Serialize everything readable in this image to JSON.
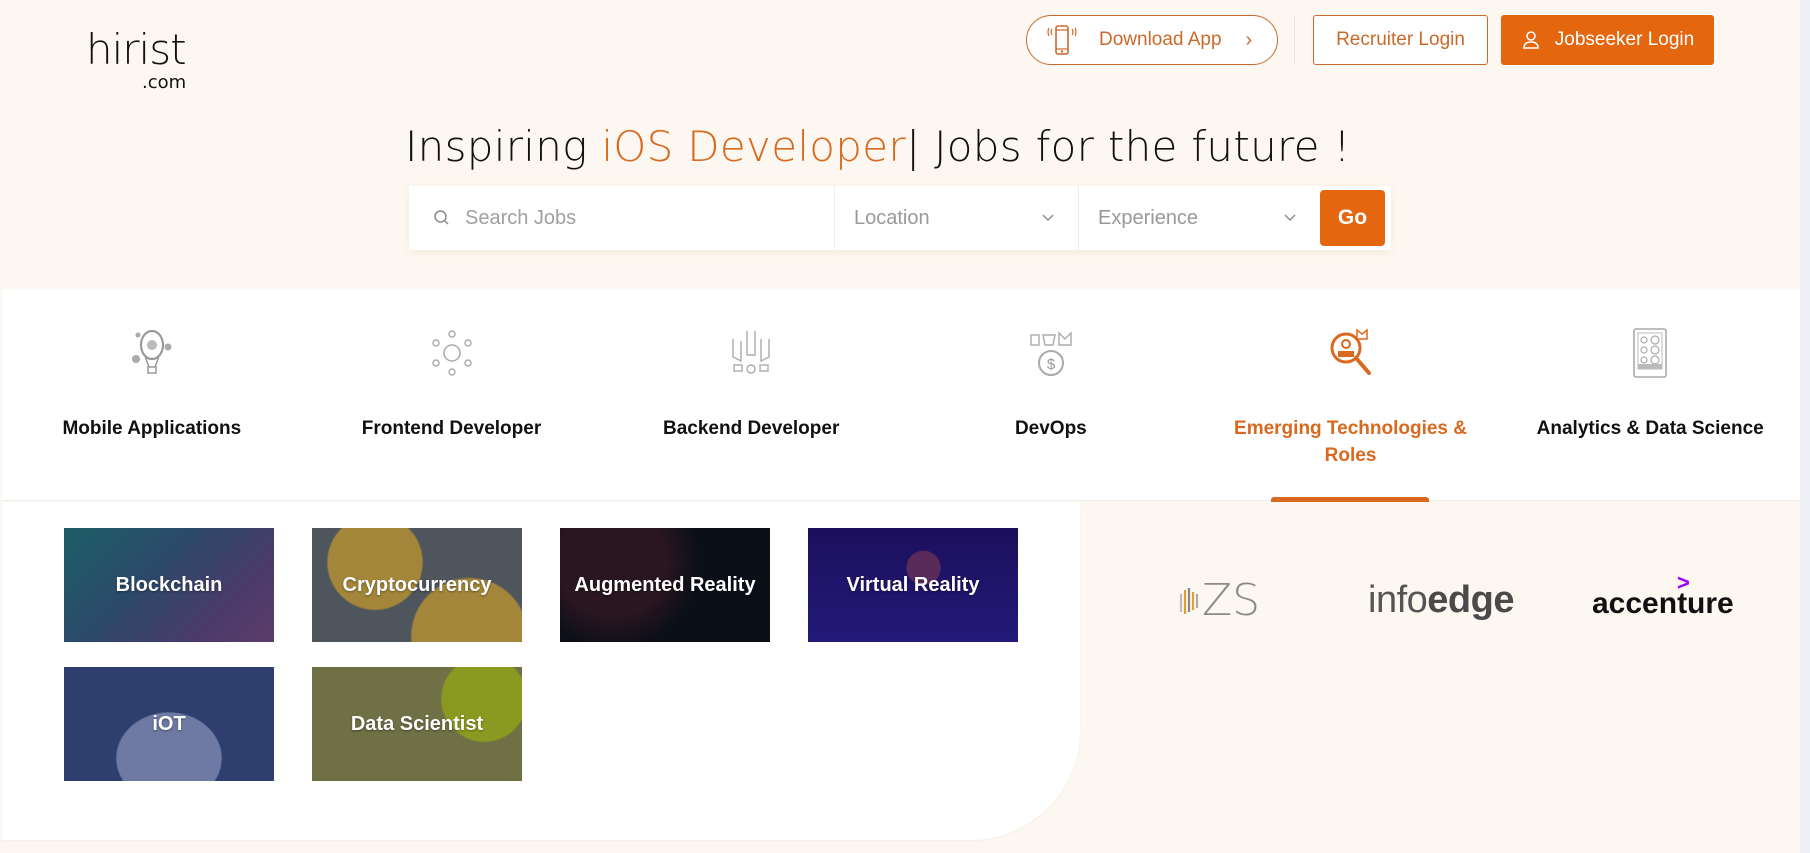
{
  "header": {
    "logo_main": "hirist",
    "logo_sub": ".com",
    "download_app": "Download App",
    "download_chevron": "›",
    "recruiter_login": "Recruiter Login",
    "jobseeker_login": "Jobseeker Login"
  },
  "hero": {
    "title_prefix": "Inspiring ",
    "title_accent": "iOS Developer",
    "title_caret": "|",
    "title_suffix": " Jobs for the future !"
  },
  "search": {
    "placeholder": "Search Jobs",
    "location_label": "Location",
    "experience_label": "Experience",
    "go_label": "Go"
  },
  "categories": [
    {
      "label": "Mobile Applications",
      "icon": "balloon-icon",
      "active": false
    },
    {
      "label": "Frontend Developer",
      "icon": "team-circle-icon",
      "active": false
    },
    {
      "label": "Backend Developer",
      "icon": "raised-hands-icon",
      "active": false
    },
    {
      "label": "DevOps",
      "icon": "money-bag-icon",
      "active": false
    },
    {
      "label": "Emerging Technologies & Roles",
      "icon": "search-person-icon",
      "active": true
    },
    {
      "label": "Analytics & Data Science",
      "icon": "tablet-dashboard-icon",
      "active": false
    }
  ],
  "tiles": [
    {
      "label": "Blockchain"
    },
    {
      "label": "Cryptocurrency"
    },
    {
      "label": "Augmented Reality"
    },
    {
      "label": "Virtual Reality"
    },
    {
      "label": "iOT"
    },
    {
      "label": "Data Scientist"
    }
  ],
  "companies": [
    {
      "name": "ZS"
    },
    {
      "name_light": "info",
      "name_bold": "edge"
    },
    {
      "name": "accenture",
      "mark": ">"
    }
  ],
  "colors": {
    "accent": "#e4670f",
    "accent_text": "#d9691e",
    "background": "#fcf8f1"
  }
}
